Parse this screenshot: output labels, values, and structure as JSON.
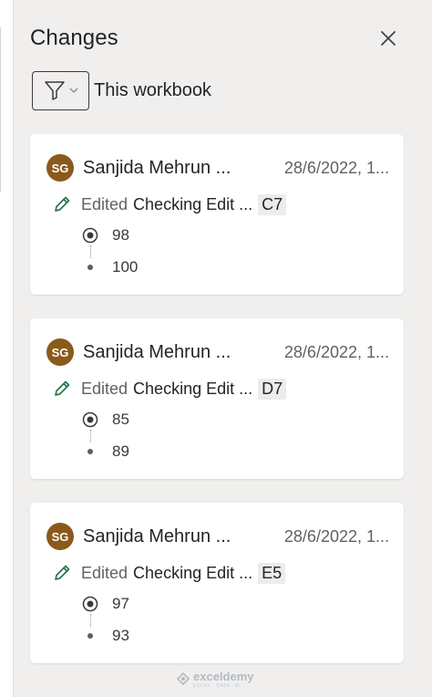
{
  "pane": {
    "title": "Changes",
    "filter_label": "This workbook"
  },
  "changes": [
    {
      "avatar_initials": "SG",
      "author": "Sanjida Mehrun ...",
      "date": "28/6/2022, 1...",
      "verb": "Edited",
      "target": "Checking Edit ...",
      "cell": "C7",
      "new_value": "98",
      "old_value": "100"
    },
    {
      "avatar_initials": "SG",
      "author": "Sanjida Mehrun ...",
      "date": "28/6/2022, 1...",
      "verb": "Edited",
      "target": "Checking Edit ...",
      "cell": "D7",
      "new_value": "85",
      "old_value": "89"
    },
    {
      "avatar_initials": "SG",
      "author": "Sanjida Mehrun ...",
      "date": "28/6/2022, 1...",
      "verb": "Edited",
      "target": "Checking Edit ...",
      "cell": "E5",
      "new_value": "97",
      "old_value": "93"
    }
  ],
  "watermark": {
    "brand": "exceldemy",
    "tagline": "EXCEL · DATA · BI"
  },
  "colors": {
    "avatar": "#8a5a1b",
    "pencil": "#217346",
    "pane_bg": "#f0efee"
  },
  "icons": {
    "close": "close-icon",
    "filter": "filter-icon",
    "pencil": "pencil-icon",
    "new_value": "radio-selected-icon",
    "old_value": "dot-icon"
  }
}
